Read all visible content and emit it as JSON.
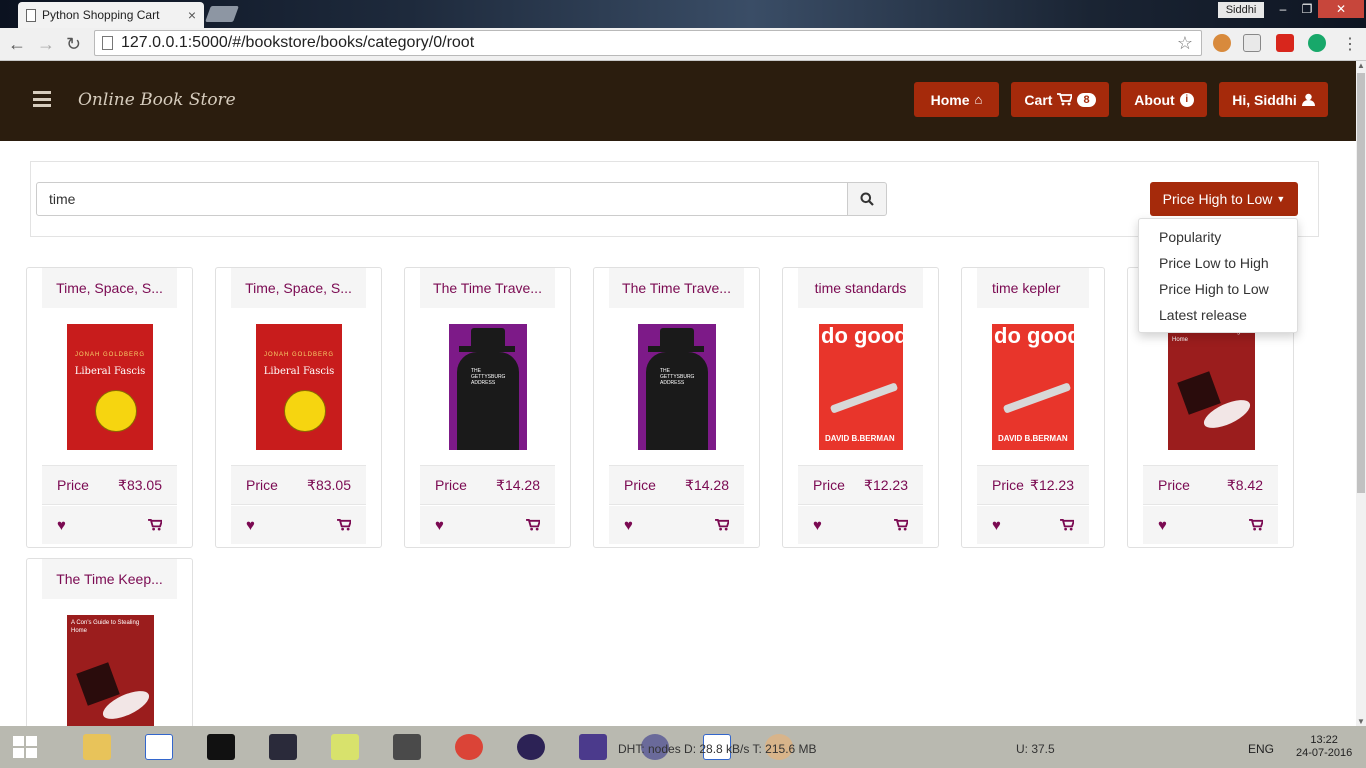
{
  "browser": {
    "tab_title": "Python Shopping Cart",
    "user": "Siddhi",
    "url": "127.0.0.1:5000/#/bookstore/books/category/0/root"
  },
  "nav": {
    "brand": "Online Book Store",
    "home": "Home",
    "cart": "Cart",
    "cart_count": "8",
    "about": "About",
    "greeting": "Hi, Siddhi"
  },
  "search": {
    "value": "time",
    "sort_label": "Price High to Low",
    "sort_options": [
      "Popularity",
      "Price Low to High",
      "Price High to Low",
      "Latest release"
    ]
  },
  "price_label": "Price",
  "books": [
    {
      "title": "Time, Space, S...",
      "price": "₹83.05",
      "cover": "Liberal Fascis",
      "cover_author": "JONAH GOLDBERG"
    },
    {
      "title": "Time, Space, S...",
      "price": "₹83.05",
      "cover": "Liberal Fascis",
      "cover_author": "JONAH GOLDBERG"
    },
    {
      "title": "The Time Trave...",
      "price": "₹14.28",
      "cover": "THE GETTYSBURG ADDRESS"
    },
    {
      "title": "The Time Trave...",
      "price": "₹14.28",
      "cover": "THE GETTYSBURG ADDRESS"
    },
    {
      "title": "time standards",
      "price": "₹12.23",
      "cover": "do good design",
      "cover_author": "DAVID B.BERMAN"
    },
    {
      "title": "time kepler",
      "price": "₹12.23",
      "cover": "do good design",
      "cover_author": "DAVID B.BERMAN"
    },
    {
      "title": "",
      "price": "₹8.42",
      "cover": "A Con's Guide to Stealing Home"
    },
    {
      "title": "The Time Keep...",
      "price": "",
      "cover": "A Con's Guide to Stealing Home"
    }
  ],
  "taskbar": {
    "status": "DHT: nodes D: 28.8 kB/s T: 215.6 MB",
    "usage": "U: 37.5",
    "lang": "ENG",
    "time": "13:22",
    "date": "24-07-2016"
  },
  "colors": {
    "accent": "#a52a0b",
    "nav_bg": "#2b1d0e",
    "text_purple": "#7b0a52"
  }
}
